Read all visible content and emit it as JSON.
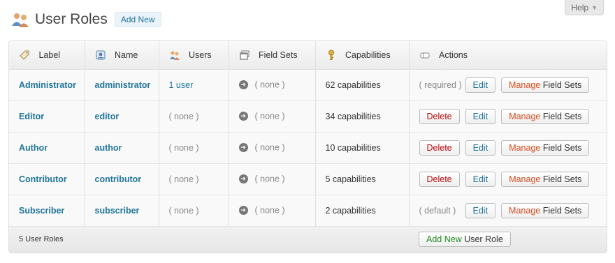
{
  "header": {
    "title": "User Roles",
    "add_new": "Add New",
    "help": "Help"
  },
  "table": {
    "columns": [
      {
        "label": "Label",
        "icon": "tag-icon"
      },
      {
        "label": "Name",
        "icon": "id-card-icon"
      },
      {
        "label": "Users",
        "icon": "users-icon"
      },
      {
        "label": "Field Sets",
        "icon": "windows-icon"
      },
      {
        "label": "Capabilities",
        "icon": "key-icon"
      },
      {
        "label": "Actions",
        "icon": "eraser-icon"
      }
    ],
    "rows": [
      {
        "label": "Administrator",
        "name": "administrator",
        "users": "1 user",
        "field_sets": "( none )",
        "capabilities": "62 capabilities",
        "status": "( required )",
        "delete": "",
        "edit": "Edit",
        "manage_verb": "Manage",
        "manage_rest": " Field Sets"
      },
      {
        "label": "Editor",
        "name": "editor",
        "users": "( none )",
        "field_sets": "( none )",
        "capabilities": "34 capabilities",
        "status": "",
        "delete": "Delete",
        "edit": "Edit",
        "manage_verb": "Manage",
        "manage_rest": " Field Sets"
      },
      {
        "label": "Author",
        "name": "author",
        "users": "( none )",
        "field_sets": "( none )",
        "capabilities": "10 capabilities",
        "status": "",
        "delete": "Delete",
        "edit": "Edit",
        "manage_verb": "Manage",
        "manage_rest": " Field Sets"
      },
      {
        "label": "Contributor",
        "name": "contributor",
        "users": "( none )",
        "field_sets": "( none )",
        "capabilities": "5 capabilities",
        "status": "",
        "delete": "Delete",
        "edit": "Edit",
        "manage_verb": "Manage",
        "manage_rest": " Field Sets"
      },
      {
        "label": "Subscriber",
        "name": "subscriber",
        "users": "( none )",
        "field_sets": "( none )",
        "capabilities": "2 capabilities",
        "status": "( default )",
        "delete": "",
        "edit": "Edit",
        "manage_verb": "Manage",
        "manage_rest": " Field Sets"
      }
    ],
    "footer": {
      "count": "5 User Roles",
      "add_role_verb": "Add New",
      "add_role_rest": " User Role"
    }
  },
  "colors": {
    "link": "#21759b",
    "delete": "#bc0b0b",
    "manage_verb": "#d54e21",
    "add_verb": "#218a21"
  }
}
